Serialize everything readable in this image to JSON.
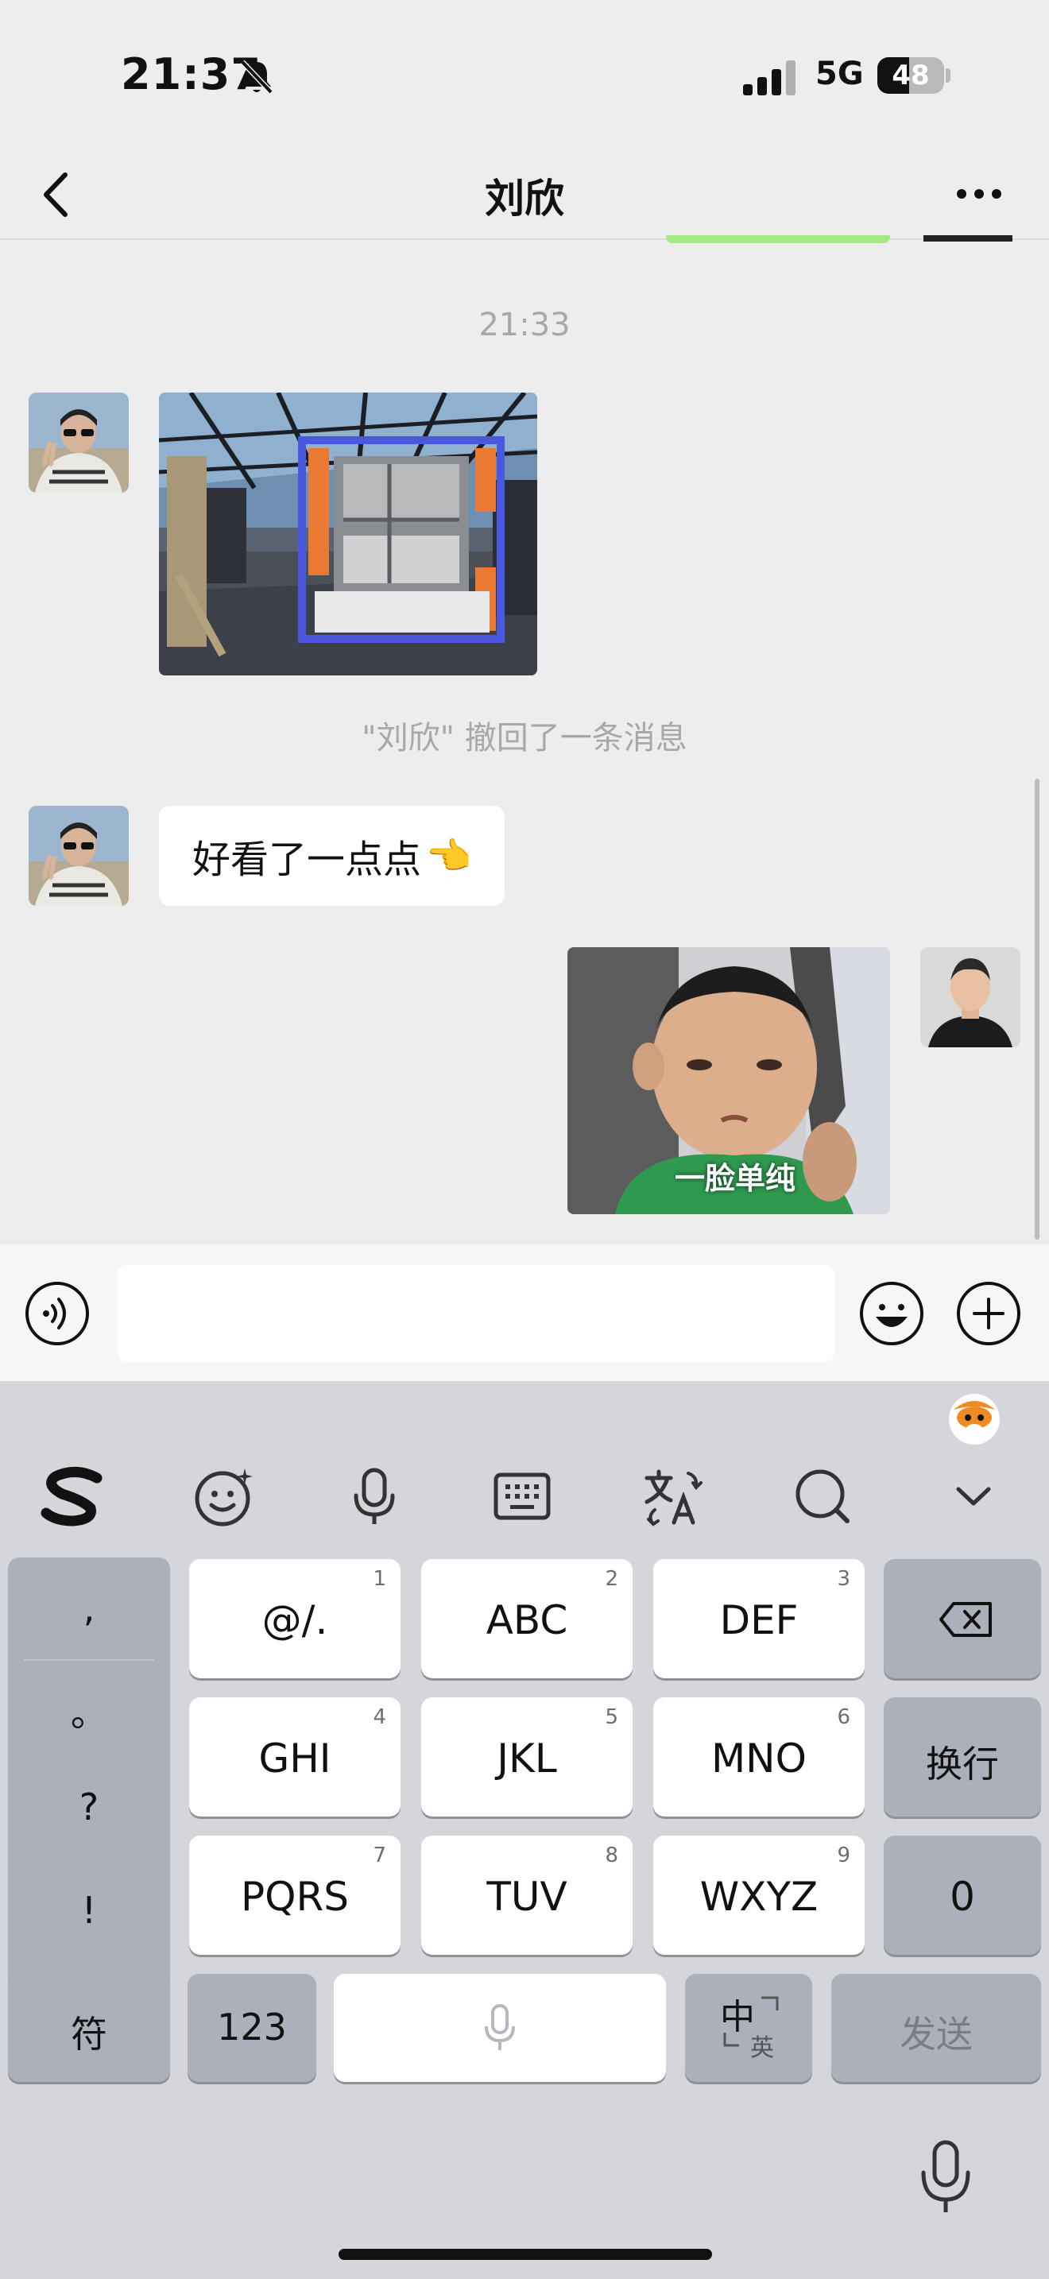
{
  "status_bar": {
    "time": "21:37",
    "network": "5G",
    "battery": "48",
    "battery_level": 0.48
  },
  "nav": {
    "title": "刘欣"
  },
  "chat": {
    "timestamp": "21:33",
    "recall_notice": "\"刘欣\" 撤回了一条消息",
    "text_message": "好看了一点点",
    "text_message_emoji": "👈",
    "sticker_caption": "一脸单纯"
  },
  "input": {
    "placeholder": "",
    "value": ""
  },
  "keyboard": {
    "punctuation": [
      ",",
      "。",
      "?",
      "!"
    ],
    "rows": [
      [
        {
          "label": "@/.",
          "digit": "1"
        },
        {
          "label": "ABC",
          "digit": "2"
        },
        {
          "label": "DEF",
          "digit": "3"
        }
      ],
      [
        {
          "label": "GHI",
          "digit": "4"
        },
        {
          "label": "JKL",
          "digit": "5"
        },
        {
          "label": "MNO",
          "digit": "6"
        }
      ],
      [
        {
          "label": "PQRS",
          "digit": "7"
        },
        {
          "label": "TUV",
          "digit": "8"
        },
        {
          "label": "WXYZ",
          "digit": "9"
        }
      ]
    ],
    "newline_label": "换行",
    "zero_label": "0",
    "symbols_label": "符",
    "numbers_label": "123",
    "lang_primary": "中",
    "lang_secondary": "英",
    "send_label": "发送"
  },
  "colors": {
    "app_bg": "#ededed",
    "accent_green": "#a6e881",
    "keyboard_bg": "#d4d6dc",
    "function_key": "#abb0ba"
  }
}
